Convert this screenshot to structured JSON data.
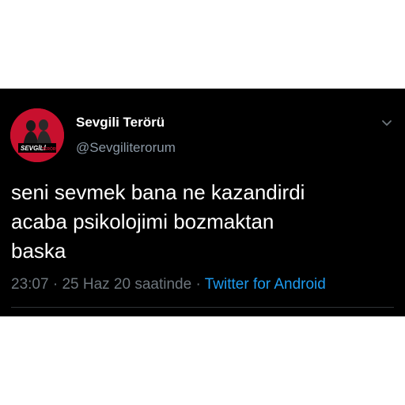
{
  "tweet": {
    "display_name": "Sevgili Terörü",
    "handle": "@Sevgiliterorum",
    "avatar_logo_text": "SEVGİLİ TERÖRÜ",
    "text_lines": [
      "seni sevmek bana ne kazandirdi",
      "acaba psikolojimi bozmaktan",
      "baska"
    ],
    "time": "23:07",
    "separator": "·",
    "date": "25 Haz 20 saatinde",
    "source": "Twitter for Android",
    "menu_icon": "chevron-down-icon"
  },
  "colors": {
    "background": "#000000",
    "text": "#ffffff",
    "muted": "#6e767d",
    "link": "#1d9bf0",
    "avatar_bg": "#c8102e"
  }
}
